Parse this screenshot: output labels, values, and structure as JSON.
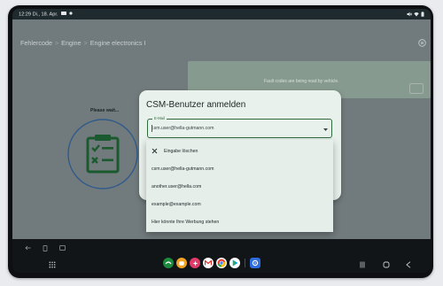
{
  "status_bar": {
    "time": "12:29",
    "date": "Di., 18. Apr."
  },
  "breadcrumb": [
    "Fehlercode",
    "Engine",
    "Engine electronics I"
  ],
  "fault_banner": {
    "text": "Fault codes are being read by vehicle."
  },
  "progress": {
    "text": "Please wait..."
  },
  "dialog": {
    "title": "CSM-Benutzer anmelden",
    "email_label": "E-Mail",
    "email_value": "csm.user@hella-gutmann.com"
  },
  "dropdown": {
    "clear_label": "Eingabe löschen",
    "options": [
      "csm.user@hella-gutmann.com",
      "another.user@hella.com",
      "example@example.com",
      "Hier könnte Ihre Werbung stehen"
    ]
  },
  "dock": {
    "apps": [
      {
        "name": "phone",
        "color": "#1c8a3c"
      },
      {
        "name": "messages",
        "color": "#f0a422"
      },
      {
        "name": "gallery",
        "color": "#e23a6b"
      },
      {
        "name": "gmail",
        "color": "#ffffff"
      },
      {
        "name": "chrome",
        "color": "#ffffff"
      },
      {
        "name": "play-store",
        "color": "#ffffff"
      },
      {
        "name": "settings",
        "color": "#2d6cdf"
      }
    ]
  },
  "colors": {
    "accent": "#2d6b3d",
    "banner": "#869a8f",
    "dialog_bg": "#e9f1ec",
    "overlay": "#717a7c"
  }
}
